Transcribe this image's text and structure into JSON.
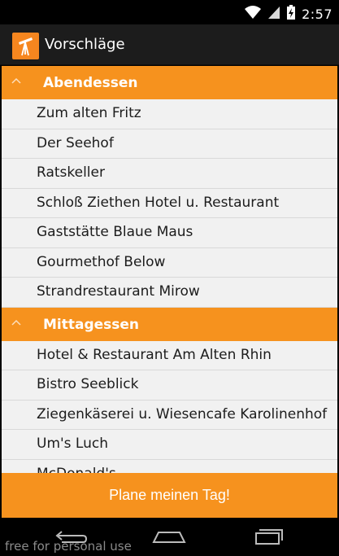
{
  "status_bar": {
    "time": "2:57"
  },
  "action_bar": {
    "title": "Vorschläge"
  },
  "groups": [
    {
      "title": "Abendessen",
      "items": [
        "Zum alten Fritz",
        "Der Seehof",
        "Ratskeller",
        "Schloß Ziethen Hotel u. Restaurant",
        "Gaststätte Blaue Maus",
        "Gourmethof Below",
        "Strandrestaurant Mirow"
      ]
    },
    {
      "title": "Mittagessen",
      "items": [
        "Hotel & Restaurant Am Alten Rhin",
        "Bistro Seeblick",
        "Ziegenkäserei u. Wiesencafe Karolinenhof",
        "Um's Luch",
        "McDonald's"
      ]
    }
  ],
  "plan_button": {
    "label": "Plane meinen Tag!"
  },
  "watermark": "free for personal use",
  "colors": {
    "accent": "#f6921e",
    "action_bar": "#1c1c1c",
    "list_bg": "#f1f1f1"
  }
}
